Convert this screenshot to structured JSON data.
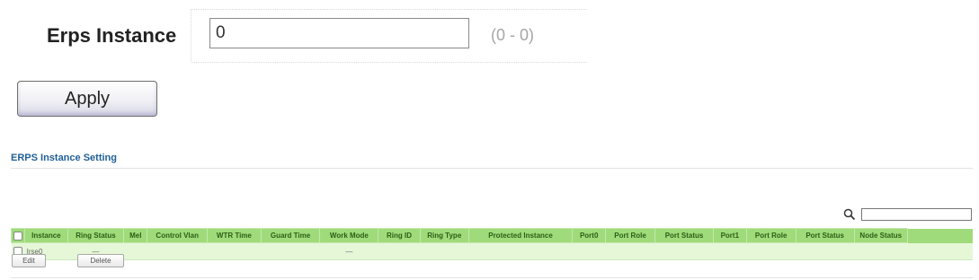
{
  "form": {
    "label": "Erps Instance",
    "input_value": "0",
    "range_hint": "(0 - 0)",
    "apply_label": "Apply"
  },
  "section": {
    "title": "ERPS Instance Setting"
  },
  "table": {
    "columns": [
      "Instance",
      "Ring Status",
      "Mel",
      "Control Vlan",
      "WTR Time",
      "Guard Time",
      "Work Mode",
      "Ring ID",
      "Ring Type",
      "Protected Instance",
      "Port0",
      "Port Role",
      "Port Status",
      "Port1",
      "Port Role",
      "Port Status",
      "Node Status"
    ],
    "rows": [
      {
        "instance": "Irse0",
        "ring_status": "—",
        "mel": "",
        "control_vlan": "",
        "wtr_time": "",
        "guard_time": "",
        "work_mode": "—",
        "ring_id": "",
        "ring_type": "",
        "protected_instance": "",
        "port0": "",
        "port0_role": "",
        "port0_status": "",
        "port1": "",
        "port1_role": "",
        "port1_status": "",
        "node_status": ""
      }
    ]
  },
  "actions": {
    "edit_label": "Edit",
    "delete_label": "Delete"
  },
  "icons": {
    "search": "search-icon"
  }
}
